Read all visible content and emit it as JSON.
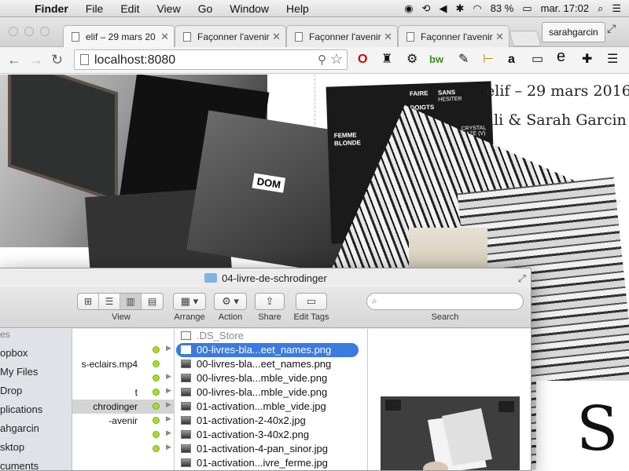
{
  "menubar": {
    "app": "Finder",
    "menus": [
      "File",
      "Edit",
      "View",
      "Go",
      "Window",
      "Help"
    ],
    "battery": "83 %",
    "clock": "mar. 17:02"
  },
  "browser": {
    "tabs": [
      {
        "title": "elif – 29 mars 20",
        "active": true
      },
      {
        "title": "Façonner l'avenir",
        "active": false
      },
      {
        "title": "Façonner l'avenir",
        "active": false
      },
      {
        "title": "Façonner l'avenir",
        "active": false
      }
    ],
    "profile": "sarahgarcin",
    "url": "localhost:8080"
  },
  "page": {
    "title_line1": "elif – 29 mars 2016",
    "title_line2": "lli & Sarah Garcin",
    "big_letter": "S",
    "card_texts": [
      "FAIRE",
      "SANS",
      "DOIGTS",
      "HESITER",
      "FEMME",
      "BLONDE",
      "CRYSTAL MAZE (V)",
      "DOM"
    ]
  },
  "finder": {
    "window_title": "04-livre-de-schrodinger",
    "toolbar": {
      "view_label": "View",
      "arrange_label": "Arrange",
      "action_label": "Action",
      "share_label": "Share",
      "edit_tags_label": "Edit Tags",
      "search_label": "Search",
      "search_placeholder": ""
    },
    "sidebar": [
      {
        "label": "es",
        "heading": true
      },
      {
        "label": "opbox",
        "heading": false
      },
      {
        "label": "My Files",
        "heading": false
      },
      {
        "label": "Drop",
        "heading": false
      },
      {
        "label": "plications",
        "heading": false
      },
      {
        "label": "ahgarcin",
        "heading": false
      },
      {
        "label": "sktop",
        "heading": false
      },
      {
        "label": "cuments",
        "heading": false
      }
    ],
    "column1": [
      {
        "label": "",
        "dot": false,
        "arrow": false,
        "selected": false
      },
      {
        "label": "",
        "dot": true,
        "arrow": true,
        "selected": false
      },
      {
        "label": "s-eclairs.mp4",
        "dot": true,
        "arrow": false,
        "selected": false
      },
      {
        "label": "",
        "dot": true,
        "arrow": true,
        "selected": false
      },
      {
        "label": "t",
        "dot": true,
        "arrow": true,
        "selected": false
      },
      {
        "label": "chrodinger",
        "dot": true,
        "arrow": true,
        "selected": true
      },
      {
        "label": "-avenir",
        "dot": true,
        "arrow": true,
        "selected": false
      },
      {
        "label": "",
        "dot": true,
        "arrow": true,
        "selected": false
      },
      {
        "label": "",
        "dot": true,
        "arrow": true,
        "selected": false
      }
    ],
    "files": [
      {
        "name": ".DS_Store",
        "hidden": true,
        "selected": false
      },
      {
        "name": "00-livres-bla...eet_names.png",
        "hidden": false,
        "selected": true
      },
      {
        "name": "00-livres-bla...eet_names.png",
        "hidden": false,
        "selected": false
      },
      {
        "name": "00-livres-bla...mble_vide.png",
        "hidden": false,
        "selected": false
      },
      {
        "name": "00-livres-bla...mble_vide.png",
        "hidden": false,
        "selected": false
      },
      {
        "name": "01-activation...mble_vide.jpg",
        "hidden": false,
        "selected": false
      },
      {
        "name": "01-activation-2-40x2.jpg",
        "hidden": false,
        "selected": false
      },
      {
        "name": "01-activation-3-40x2.png",
        "hidden": false,
        "selected": false
      },
      {
        "name": "01-activation-4-pan_sinor.jpg",
        "hidden": false,
        "selected": false
      },
      {
        "name": "01-activation...ivre_ferme.jpg",
        "hidden": false,
        "selected": false
      }
    ]
  },
  "colors": {
    "menubar_bg": "#e4e4e4",
    "selection_blue": "#3b7ae0",
    "tag_green": "#a7dc2d",
    "sidebar_bg": "#dfe3e8"
  }
}
